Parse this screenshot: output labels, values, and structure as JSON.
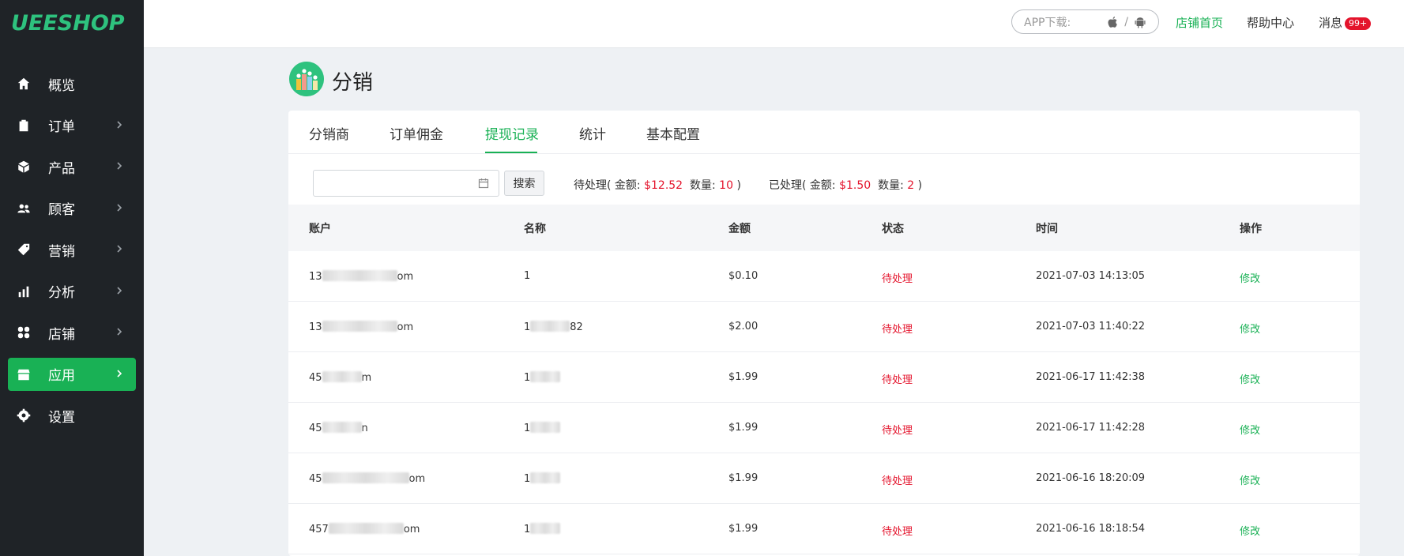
{
  "brand": {
    "logo_text": "UEESHOP"
  },
  "sidebar": {
    "items": [
      {
        "label": "概览",
        "icon": "home-icon",
        "has_chevron": false,
        "active": false
      },
      {
        "label": "订单",
        "icon": "clipboard-icon",
        "has_chevron": true,
        "active": false
      },
      {
        "label": "产品",
        "icon": "box-icon",
        "has_chevron": true,
        "active": false
      },
      {
        "label": "顾客",
        "icon": "users-icon",
        "has_chevron": true,
        "active": false
      },
      {
        "label": "营销",
        "icon": "tag-icon",
        "has_chevron": true,
        "active": false
      },
      {
        "label": "分析",
        "icon": "bar-chart-icon",
        "has_chevron": true,
        "active": false
      },
      {
        "label": "店铺",
        "icon": "grid-icon",
        "has_chevron": true,
        "active": false
      },
      {
        "label": "应用",
        "icon": "store-icon",
        "has_chevron": true,
        "active": true
      },
      {
        "label": "设置",
        "icon": "gear-icon",
        "has_chevron": false,
        "active": false
      }
    ]
  },
  "topbar": {
    "app_download_label": "APP下载:",
    "separator": "/",
    "store_home": "店铺首页",
    "help_center": "帮助中心",
    "messages": "消息",
    "messages_badge": "99+"
  },
  "page": {
    "title": "分销"
  },
  "tabs": [
    {
      "label": "分销商",
      "active": false
    },
    {
      "label": "订单佣金",
      "active": false
    },
    {
      "label": "提现记录",
      "active": true
    },
    {
      "label": "统计",
      "active": false
    },
    {
      "label": "基本配置",
      "active": false
    }
  ],
  "filter": {
    "date_value": "",
    "search_label": "搜索",
    "pending": {
      "prefix": "待处理( 金额:",
      "amount": "$12.52",
      "count_label": "数量:",
      "count": "10",
      "suffix": ")"
    },
    "processed": {
      "prefix": "已处理( 金额:",
      "amount": "$1.50",
      "count_label": "数量:",
      "count": "2",
      "suffix": ")"
    }
  },
  "table": {
    "columns": [
      "账户",
      "名称",
      "金额",
      "状态",
      "时间",
      "操作"
    ],
    "rows": [
      {
        "account_start": "13",
        "account_end": "om",
        "name_start": "1",
        "name_end": "",
        "amount": "$0.10",
        "status": "待处理",
        "time": "2021-07-03 14:13:05",
        "action": "修改"
      },
      {
        "account_start": "13",
        "account_end": "om",
        "name_start": "1",
        "name_end": "82",
        "amount": "$2.00",
        "status": "待处理",
        "time": "2021-07-03 11:40:22",
        "action": "修改"
      },
      {
        "account_start": "45",
        "account_end": "m",
        "name_start": "1",
        "name_end": "",
        "amount": "$1.99",
        "status": "待处理",
        "time": "2021-06-17 11:42:38",
        "action": "修改"
      },
      {
        "account_start": "45",
        "account_end": "n",
        "name_start": "1",
        "name_end": "",
        "amount": "$1.99",
        "status": "待处理",
        "time": "2021-06-17 11:42:28",
        "action": "修改"
      },
      {
        "account_start": "45",
        "account_end": "om",
        "name_start": "1",
        "name_end": "",
        "amount": "$1.99",
        "status": "待处理",
        "time": "2021-06-16 18:20:09",
        "action": "修改"
      },
      {
        "account_start": "457",
        "account_end": "om",
        "name_start": "1",
        "name_end": "",
        "amount": "$1.99",
        "status": "待处理",
        "time": "2021-06-16 18:18:54",
        "action": "修改"
      }
    ]
  },
  "colors": {
    "accent": "#19b155",
    "danger": "#e4142c",
    "sidebar_bg": "#1f2327"
  }
}
